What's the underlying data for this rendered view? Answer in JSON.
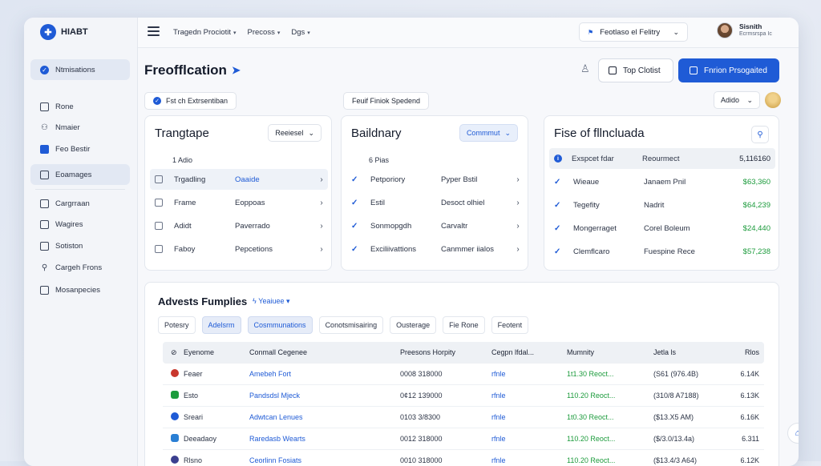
{
  "app": {
    "logo_text": "HIABT"
  },
  "sidebar": {
    "items": [
      {
        "label": "Ntmisations",
        "icon": "blue-dot-icon"
      },
      {
        "label": "Rone",
        "icon": "square-icon"
      },
      {
        "label": "Nmaier",
        "icon": "person-icon"
      },
      {
        "label": "Feo Bestir",
        "icon": "blue-square-icon"
      },
      {
        "label": "Eoamages",
        "icon": "grid-icon"
      },
      {
        "label": "Cargrraan",
        "icon": "document-icon"
      },
      {
        "label": "Wagires",
        "icon": "card-icon"
      },
      {
        "label": "Sotiston",
        "icon": "calendar-icon"
      },
      {
        "label": "Cargeh Frons",
        "icon": "pin-icon"
      },
      {
        "label": "Mosanpecies",
        "icon": "monitor-icon"
      }
    ]
  },
  "topbar": {
    "crumbs": [
      "Tragedn Prociotit",
      "Precoss",
      "Dgs"
    ],
    "select_label": "Feotlaso el Felitry",
    "user_name": "Sisnith",
    "user_role": "Ecrmsrspa Ic"
  },
  "header": {
    "title": "Freofflcation",
    "btn_secondary": "Top Clotist",
    "btn_primary": "Fnrion Prsogaited",
    "chip1": "Fst ch Extrsentiban",
    "chip2": "Feuif Finiok Spedend",
    "sort_label": "Adido"
  },
  "cards": [
    {
      "title": "Trangtape",
      "dropdown": "Reeiesel",
      "subhead": "1 Adio",
      "rows": [
        {
          "c1": "Trgadling",
          "c2": "Oaaide"
        },
        {
          "c1": "Frame",
          "c2": "Eoppoas"
        },
        {
          "c1": "Adidt",
          "c2": "Paverrado"
        },
        {
          "c1": "Faboy",
          "c2": "Pepcetions"
        }
      ]
    },
    {
      "title": "Baildnary",
      "dropdown": "Commmut",
      "subhead": "6 Pias",
      "rows": [
        {
          "c1": "Petporiory",
          "c2": "Pyper Bstil"
        },
        {
          "c1": "Estil",
          "c2": "Desoct olhiel"
        },
        {
          "c1": "Sonmopgdh",
          "c2": "Carvaltr"
        },
        {
          "c1": "Exciliivattions",
          "c2": "Canmmer iialos"
        }
      ]
    },
    {
      "title": "Fise of fllncluada",
      "head": {
        "c1": "Exspcet fdar",
        "c2": "Reourmect",
        "amt": "5,116160"
      },
      "rows": [
        {
          "c1": "Wieaue",
          "c2": "Janaem Pnil",
          "amt": "$63,360"
        },
        {
          "c1": "Tegefity",
          "c2": "Nadrit",
          "amt": "$64,239"
        },
        {
          "c1": "Mongerraget",
          "c2": "Corel Boleum",
          "amt": "$24,440"
        },
        {
          "c1": "Clemflcaro",
          "c2": "Fuespine Rece",
          "amt": "$57,238"
        }
      ]
    }
  ],
  "panel": {
    "title": "Advests Fumplies",
    "dropdown": "Yeaiuee",
    "tabs": [
      "Potesry",
      "Adelsrm",
      "Cosmmunations",
      "Conotsmisairing",
      "Ousterage",
      "Fie Rone",
      "Feotent"
    ],
    "columns": [
      "Eyenome",
      "Conmall Cegenee",
      "Preesons Horpity",
      "Cegpn lfdal...",
      "Mumnity",
      "Jetla ls",
      "Rlos"
    ],
    "rows": [
      {
        "icon_color": "#c8372d",
        "a": "Feaer",
        "b": "Amebeh Fort",
        "c": "0008 318000",
        "d": "rfnle",
        "e": "1t1.30 Reoct...",
        "f": "(S61 (976.4B)",
        "g": "6.14K"
      },
      {
        "icon_color": "#1c9b3c",
        "a": "Esto",
        "b": "Pandsdsl Mjeck",
        "c": "0¢12 139000",
        "d": "rfnle",
        "e": "110.20 Reoct...",
        "f": "(310/8 A7188)",
        "g": "6.13K"
      },
      {
        "icon_color": "#1f5bd6",
        "a": "Sreari",
        "b": "Adwtcan Lenues",
        "c": "0103 3/8300",
        "d": "rfnle",
        "e": "1t0.30 Reoct...",
        "f": "($13.X5 AM)",
        "g": "6.16K"
      },
      {
        "icon_color": "#2a7fd4",
        "a": "Deeadaoy",
        "b": "Raredasb Wearts",
        "c": "0012 318000",
        "d": "rfnle",
        "e": "110.20 Reoct...",
        "f": "($/3.0/13.4a)",
        "g": "6.311"
      },
      {
        "icon_color": "#3b3f8f",
        "a": "Rlsno",
        "b": "Ceorlinn Fosiats",
        "c": "0010 318000",
        "d": "rfnle",
        "e": "110.20 Reoct...",
        "f": "($13.4/3 A64)",
        "g": "6.12K"
      }
    ]
  }
}
